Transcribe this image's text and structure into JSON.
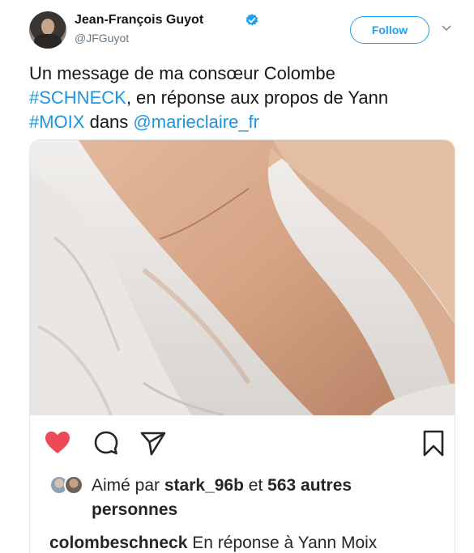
{
  "author": {
    "name": "Jean-François Guyot",
    "handle": "@JFGuyot",
    "verified": true
  },
  "follow_button": {
    "label": "Follow"
  },
  "tweet": {
    "line1": "Un message de ma consœur Colombe",
    "hashtag1": "#SCHNECK",
    "line2_rest": ", en réponse aux propos de Yann",
    "hashtag2": "#MOIX",
    "dans": " dans ",
    "mention": "@marieclaire_fr"
  },
  "instagram": {
    "icons": [
      "heart-filled-icon",
      "comment-icon",
      "share-icon",
      "bookmark-icon"
    ],
    "likes": {
      "prefix": "Aimé par",
      "user": "stark_96b",
      "et": "et",
      "count": "563 autres",
      "suffix": "personnes"
    },
    "comment": {
      "user": "colombeschneck",
      "text": "En réponse à Yann Moix"
    }
  },
  "colors": {
    "link": "#1b95e0",
    "follow": "#1da1f2",
    "heart": "#ed4956",
    "verified": "#1da1f2"
  }
}
